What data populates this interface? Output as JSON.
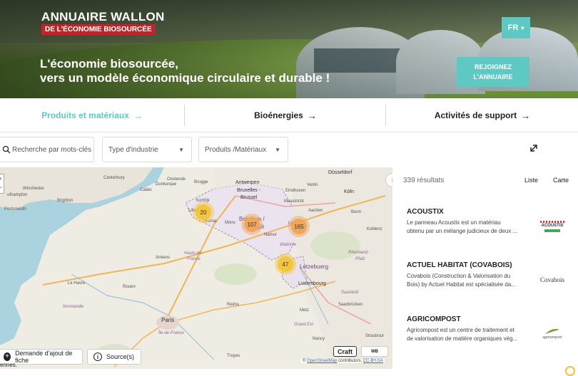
{
  "hero": {
    "title": "ANNUAIRE WALLON",
    "subtitle": "DE L'ÉCONOMIE BIOSOURCÉE",
    "headline_line1": "L'économie biosourcée,",
    "headline_line2": "vers un modèle économique circulaire et durable !",
    "lang": "FR",
    "join_line1": "REJOIGNEZ",
    "join_line2": "L'ANNUAIRE"
  },
  "categories": [
    {
      "label": "Produits et matériaux",
      "arrow": "→"
    },
    {
      "label": "Bioénergies",
      "arrow": "→"
    },
    {
      "label": "Activités de support",
      "arrow": "→"
    }
  ],
  "filters": {
    "search_placeholder": "Recherche par mots-clés",
    "type_label": "Type d'industrie",
    "products_label": "Produits /Matériaux"
  },
  "map": {
    "clusters": [
      {
        "count": "20"
      },
      {
        "count": "107"
      },
      {
        "count": "165"
      },
      {
        "count": "47"
      }
    ],
    "places": [
      "Canterbury",
      "Winchester",
      "uthampton",
      "Brighton",
      "Portsmouth",
      "Calais",
      "Dunkerque",
      "Oostende",
      "Brugge",
      "Antwerpen",
      "Bruxelles -",
      "Brussel",
      "Kortrijk",
      "Lille",
      "Tournai",
      "Mons",
      "Belgique /",
      "België",
      "Düsseldorf",
      "Köln",
      "Maastricht",
      "Bonn",
      "Koblenz",
      "Wallonie",
      "Rheinland-",
      "Pfalz",
      "Letzebuerg",
      "Luxembourg",
      "Saarland",
      "Saarbrücken",
      "Metz",
      "Nancy",
      "Strasbour",
      "Reims",
      "Amiens",
      "Hauts-de-",
      "France",
      "Le Havre",
      "Rouen",
      "Normandie",
      "Paris",
      "Île-de-France",
      "Grand Est",
      "Troyes",
      "Venlo",
      "Eindhoven",
      "Aachen",
      "Namur",
      "Liège"
    ],
    "btn_request": "Demande d'ajout de fiche",
    "btn_sources": "Source(s)",
    "attribution_prefix": "©",
    "attribution_osm": "OpenStreetMap",
    "attribution_mid": "contributors,",
    "attribution_license": "CC-BY-SA",
    "badge_craft": "Craft",
    "badge_wb": "WB",
    "cut_text": "ennes."
  },
  "results": {
    "count_text": "339 résultats",
    "view_list": "Liste",
    "view_map": "Carte",
    "items": [
      {
        "title": "ACOUSTIX",
        "desc_line1": "Le panneau Acoustix est un matériau",
        "desc_line2": "obtenu par un mélange judicieux de deux ...",
        "logo_text": "ACOUSTIX"
      },
      {
        "title": "ACTUEL HABITAT (COVABOIS)",
        "desc_line1": "Covabois (Construction & Valorisation du",
        "desc_line2": "Bois) by Actuel Habitat est spécialisée da...",
        "logo_text": "Covabois"
      },
      {
        "title": "AGRICOMPOST",
        "desc_line1": "Agricompost est un centre de traitement et",
        "desc_line2": "de valorisation de matière organiques vég...",
        "logo_text": "agricompost"
      }
    ]
  },
  "colors": {
    "accent": "#5ec8c3",
    "brand_red": "#b8282b",
    "cluster_yellow": "#f3c53c",
    "cluster_orange": "#f0a55a"
  }
}
